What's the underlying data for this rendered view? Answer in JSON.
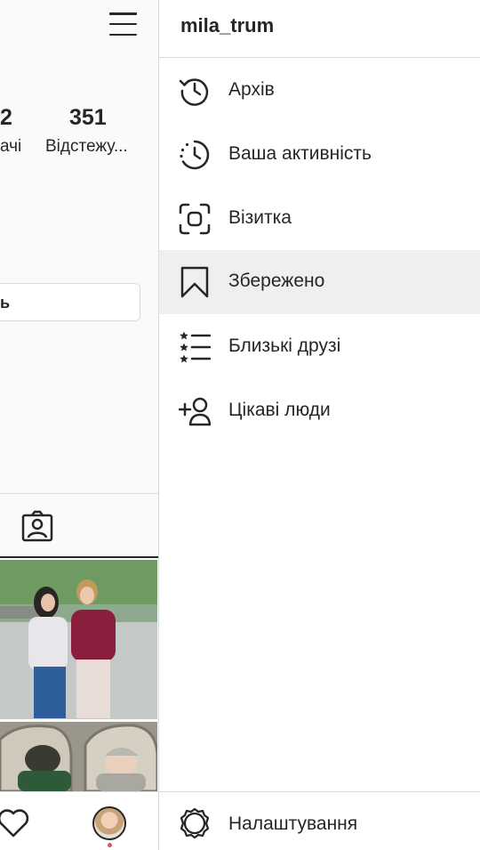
{
  "profile": {
    "stat_followers_value": "2",
    "stat_followers_label": "ачі",
    "stat_following_value": "351",
    "stat_following_label": "Відстежу...",
    "edit_button_label": "ь"
  },
  "drawer": {
    "username": "mila_trum",
    "items": [
      {
        "label": "Архів",
        "icon": "archive-icon"
      },
      {
        "label": "Ваша активність",
        "icon": "activity-icon"
      },
      {
        "label": "Візитка",
        "icon": "nametag-icon"
      },
      {
        "label": "Збережено",
        "icon": "bookmark-icon",
        "active": true
      },
      {
        "label": "Близькі друзі",
        "icon": "close-friends-icon"
      },
      {
        "label": "Цікаві люди",
        "icon": "discover-people-icon"
      }
    ],
    "settings_label": "Налаштування"
  },
  "colors": {
    "text": "#262626",
    "divider": "#dbdbdb",
    "active_bg": "#efefef",
    "notification": "#ed4956"
  }
}
